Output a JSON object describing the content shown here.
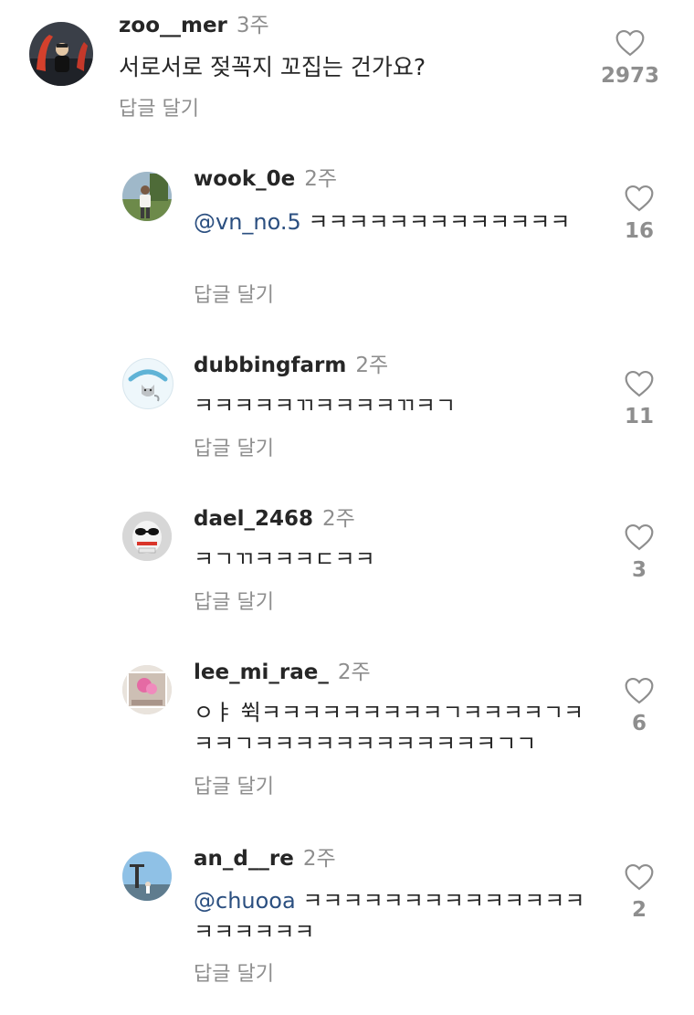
{
  "comments": [
    {
      "username": "zoo__mer",
      "time": "3주",
      "mention": "",
      "text": "서로서로 젖꼭지 꼬집는 건가요?",
      "reply_label": "답글 달기",
      "likes": "2973",
      "avatar_icon": "photo-avatar-car"
    },
    {
      "username": "wook_0e",
      "time": "2주",
      "mention": "@vn_no.5",
      "text": " ㅋㅋㅋㅋㅋㅋㅋㅋㅋㅋㅋㅋㅋ",
      "reply_label": "답글 달기",
      "likes": "16",
      "avatar_icon": "photo-avatar-person"
    },
    {
      "username": "dubbingfarm",
      "time": "2주",
      "mention": "",
      "text": "ㅋㅋㅋㅋㅋㄲㅋㅋㅋㅋㄲㅋㄱ",
      "reply_label": "답글 달기",
      "likes": "11",
      "avatar_icon": "cat-logo-avatar"
    },
    {
      "username": "dael_2468",
      "time": "2주",
      "mention": "",
      "text": "ㅋㄱㄲㅋㅋㅋㄷㅋㅋ",
      "reply_label": "답글 달기",
      "likes": "3",
      "avatar_icon": "sunglasses-character-avatar"
    },
    {
      "username": "lee_mi_rae_",
      "time": "2주",
      "mention": "",
      "text": "ㅇㅑ 쒹ㅋㅋㅋㅋㅋㅋㅋㅋㅋㄱㅋㅋㅋㅋㄱㅋㅋㅋㄱㅋㅋㅋㅋㅋㅋㅋㅋㅋㅋㅋㅋㄱㄱ",
      "reply_label": "답글 달기",
      "likes": "6",
      "avatar_icon": "photo-avatar-doll"
    },
    {
      "username": "an_d__re",
      "time": "2주",
      "mention": "@chuooa",
      "text": " ㅋㅋㅋㅋㅋㅋㅋㅋㅋㅋㅋㅋㅋㅋㅋㅋㅋㅋㅋㅋ",
      "reply_label": "답글 달기",
      "likes": "2",
      "avatar_icon": "photo-avatar-landscape"
    }
  ]
}
